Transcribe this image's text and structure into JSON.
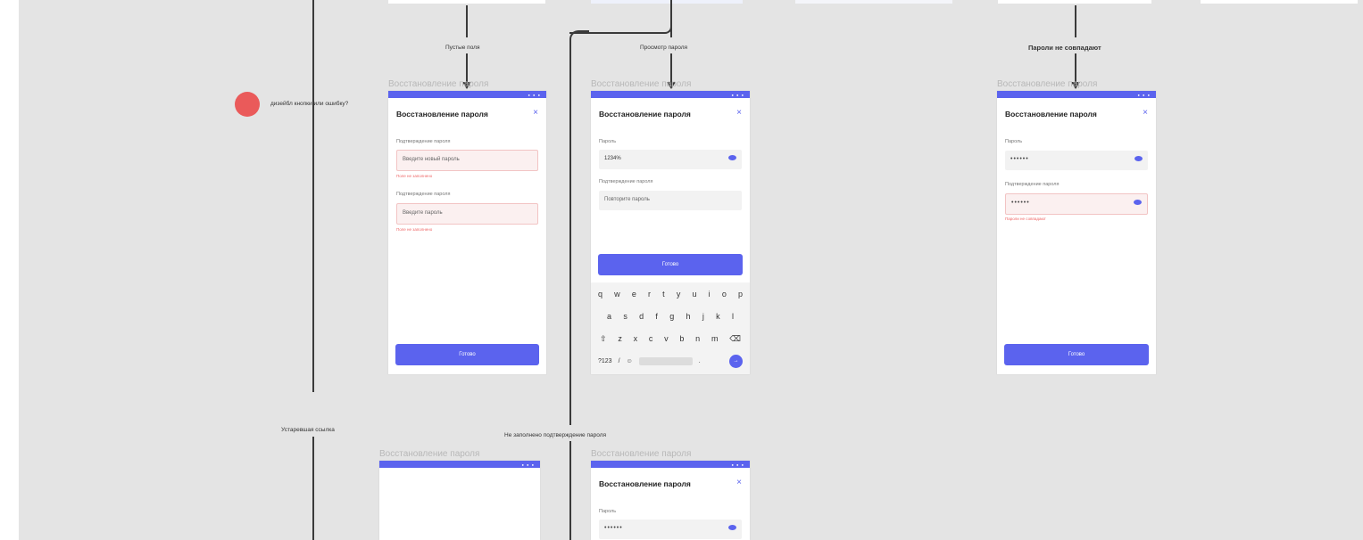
{
  "flow_labels": {
    "empty_fields": "Пустые поля",
    "view_password": "Просмотр пароля",
    "passwords_mismatch": "Пароли не совпадают",
    "link_expired": "Устаревшая ссылка",
    "confirmation_not_filled": "Не заполнено подтверждение пароля",
    "comment": "дизейбл кнопки или ошибку?"
  },
  "frame_title": "Восстановление пароля",
  "screen": {
    "header": "Восстановление пароля",
    "close_icon": "×",
    "status_dots": "● ● ●",
    "password_label": "Пароль",
    "confirm_label": "Подтверждение пароля",
    "new_password_placeholder": "Введите новый пароль",
    "repeat_placeholder": "Повторите пароль",
    "enter_password_placeholder": "Введите пароль",
    "required_error": "Поле не заполнено",
    "mismatch_error": "Пароли не совпадают",
    "typed_value": "1234%",
    "masked_value": "••••••",
    "submit_button": "Готово"
  },
  "keyboard": {
    "row1": [
      "q",
      "w",
      "e",
      "r",
      "t",
      "y",
      "u",
      "i",
      "o",
      "p"
    ],
    "row2": [
      "a",
      "s",
      "d",
      "f",
      "g",
      "h",
      "j",
      "k",
      "l"
    ],
    "row3": [
      "⇧",
      "z",
      "x",
      "c",
      "v",
      "b",
      "n",
      "m",
      "⌫"
    ],
    "row4_left": "?123",
    "row4_slash": "/",
    "row4_emoji": "☺",
    "row4_dot": ".",
    "go": "→"
  },
  "colors": {
    "accent": "#5b63ee",
    "error": "#ea5a5a",
    "canvas": "#e4e4e4"
  }
}
